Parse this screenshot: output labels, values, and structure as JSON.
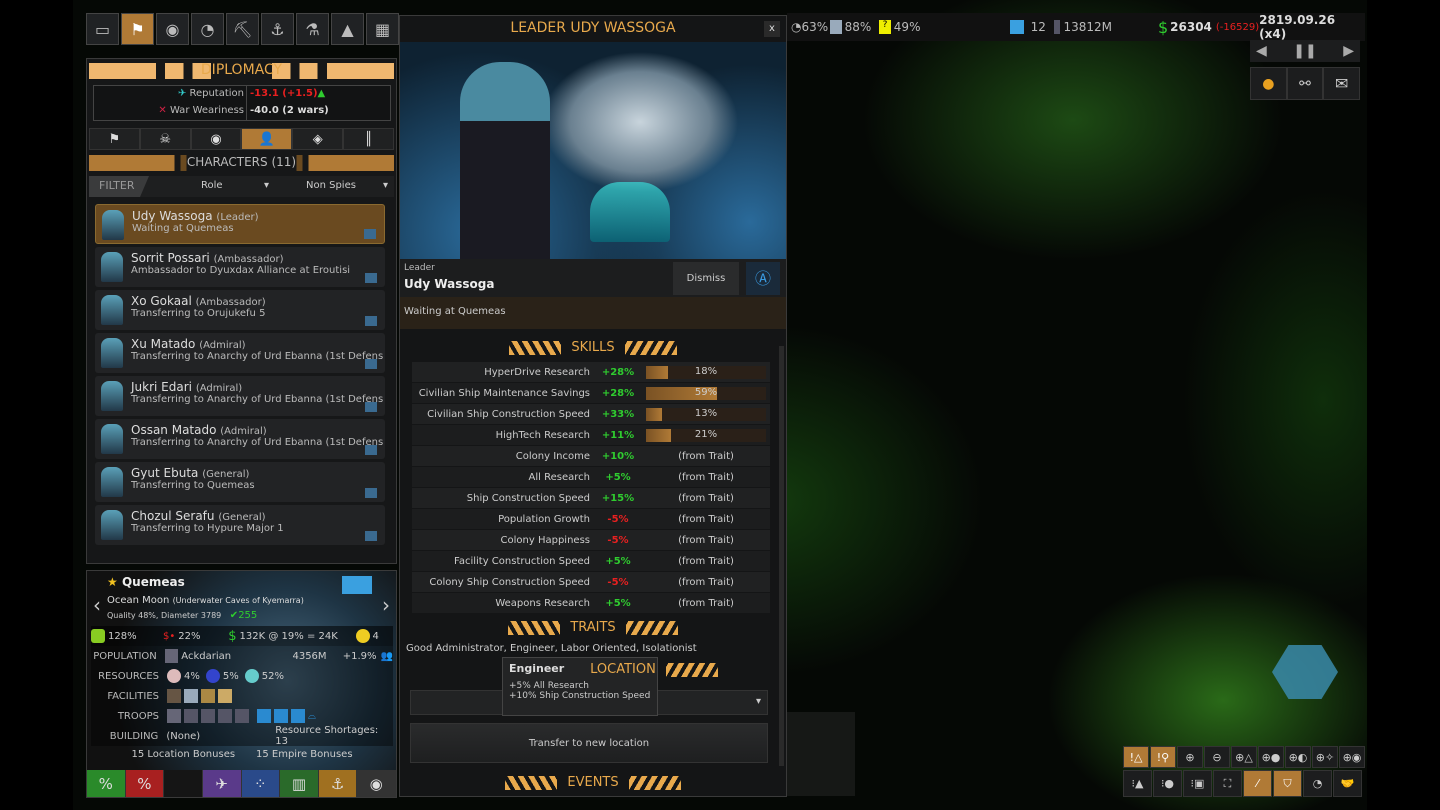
{
  "colors": {
    "accent": "#e8a94c",
    "positive": "#2fcc2f",
    "negative": "#e82020",
    "selected": "#6a4a20"
  },
  "top_icons": [
    {
      "icon": "empire-flag-icon"
    },
    {
      "icon": "diplomacy-flags-icon",
      "active": true
    },
    {
      "icon": "planet-flag-icon"
    },
    {
      "icon": "radar-icon"
    },
    {
      "icon": "pickaxe-icon"
    },
    {
      "icon": "crane-hook-icon"
    },
    {
      "icon": "flask-icon"
    },
    {
      "icon": "fleet-icon"
    },
    {
      "icon": "buildings-icon"
    }
  ],
  "diplomacy": {
    "title": "DIPLOMACY",
    "reputation_label": "Reputation",
    "reputation_value": "-13.1 (+1.5)",
    "war_label": "War Weariness",
    "war_value": "-40.0 (2 wars)",
    "tabs": [
      {
        "icon": "flags-icon"
      },
      {
        "icon": "skull-icon"
      },
      {
        "icon": "planet-flag-icon"
      },
      {
        "icon": "person-icon",
        "active": true
      },
      {
        "icon": "spy-icon"
      },
      {
        "icon": "chart-icon"
      }
    ],
    "characters_title": "CHARACTERS (11)",
    "filter": {
      "label": "FILTER",
      "role": "Role",
      "spies": "Non Spies"
    },
    "characters": [
      {
        "name": "Udy Wassoga",
        "role": "(Leader)",
        "status": "Waiting at Quemeas",
        "selected": true
      },
      {
        "name": "Sorrit Possari",
        "role": "(Ambassador)",
        "status": "Ambassador to Dyuxdax Alliance at Eroutisi"
      },
      {
        "name": "Xo Gokaal",
        "role": "(Ambassador)",
        "status": "Transferring to Orujukefu 5"
      },
      {
        "name": "Xu Matado",
        "role": "(Admiral)",
        "status": "Transferring to Anarchy of Urd Ebanna  (1st Defense"
      },
      {
        "name": "Jukri Edari",
        "role": "(Admiral)",
        "status": "Transferring to Anarchy of Urd Ebanna  (1st Defense"
      },
      {
        "name": "Ossan Matado",
        "role": "(Admiral)",
        "status": "Transferring to Anarchy of Urd Ebanna  (1st Defense"
      },
      {
        "name": "Gyut Ebuta",
        "role": "(General)",
        "status": "Transferring to Quemeas"
      },
      {
        "name": "Chozul Serafu",
        "role": "(General)",
        "status": "Transferring to Hypure Major 1"
      }
    ]
  },
  "planet": {
    "name": "Quemeas",
    "type": "Ocean Moon",
    "subtitle": "(Underwater Caves of Kyemarra)",
    "quality": "Quality 48%, Diameter 3789",
    "score": "255",
    "happiness": "128%",
    "corruption": "22%",
    "income": "132K @ 19% = 24K",
    "mood": "4",
    "population_label": "POPULATION",
    "race": "Ackdarian",
    "population": "4356M",
    "growth": "+1.9%",
    "resources_label": "RESOURCES",
    "resources": [
      "4%",
      "5%",
      "52%"
    ],
    "facilities_label": "FACILITIES",
    "troops_label": "TROOPS",
    "building_label": "BUILDING",
    "building": "(None)",
    "shortages": "Resource Shortages: 13",
    "location_bonuses": "15 Location Bonuses",
    "empire_bonuses": "15 Empire Bonuses",
    "tabs": [
      {
        "icon": "money-bag-icon",
        "color": "#2a8a2a"
      },
      {
        "icon": "money-bag-red-icon",
        "color": "#a82020"
      },
      {
        "icon": "blank-tab",
        "color": "#151515"
      },
      {
        "icon": "fighter-icon",
        "color": "#5a3a8a"
      },
      {
        "icon": "dots-icon",
        "color": "#2a4a8a"
      },
      {
        "icon": "building-icon",
        "color": "#2a6a2a"
      },
      {
        "icon": "crane-hook-icon",
        "color": "#a07020"
      },
      {
        "icon": "planet-flag-icon",
        "color": "#333"
      }
    ]
  },
  "leader": {
    "title": "LEADER UDY WASSOGA",
    "close": "x",
    "role": "Leader",
    "name": "Udy Wassoga",
    "dismiss": "Dismiss",
    "status": "Waiting at Quemeas",
    "skills_title": "SKILLS",
    "skills": [
      {
        "name": "HyperDrive Research",
        "value": "+28%",
        "level": 18,
        "label": "18%"
      },
      {
        "name": "Civilian Ship Maintenance Savings",
        "value": "+28%",
        "level": 59,
        "label": "59%"
      },
      {
        "name": "Civilian Ship Construction Speed",
        "value": "+33%",
        "level": 13,
        "label": "13%"
      },
      {
        "name": "HighTech Research",
        "value": "+11%",
        "level": 21,
        "label": "21%"
      },
      {
        "name": "Colony Income",
        "value": "+10%",
        "note": "(from Trait)"
      },
      {
        "name": "All Research",
        "value": "+5%",
        "note": "(from Trait)"
      },
      {
        "name": "Ship Construction Speed",
        "value": "+15%",
        "note": "(from Trait)"
      },
      {
        "name": "Population Growth",
        "value": "-5%",
        "note": "(from Trait)"
      },
      {
        "name": "Colony Happiness",
        "value": "-5%",
        "note": "(from Trait)"
      },
      {
        "name": "Facility Construction Speed",
        "value": "+5%",
        "note": "(from Trait)"
      },
      {
        "name": "Colony Ship Construction Speed",
        "value": "-5%",
        "note": "(from Trait)"
      },
      {
        "name": "Weapons Research",
        "value": "+5%",
        "note": "(from Trait)"
      }
    ],
    "traits_title": "TRAITS",
    "traits": "Good Administrator, Engineer, Labor Oriented, Isolationist",
    "location_title": "LOCATION",
    "transfer": "Transfer to new location",
    "events_title": "EVENTS",
    "tooltip": {
      "title": "Engineer",
      "lines": [
        "+5% All Research",
        "+10% Ship Construction Speed"
      ]
    }
  },
  "topbar": {
    "stat1": "63%",
    "stat2": "88%",
    "stat3": "49%",
    "colonies": "12",
    "population": "13812M",
    "credits": "26304",
    "cashflow": "(-16529)",
    "date": "2819.09.26 (x4)"
  },
  "map_tools": {
    "row1": [
      "!△",
      "!⚲",
      "⊕",
      "⊖",
      "⊕△",
      "⊕●",
      "⊕◐",
      "⊕✧",
      "⊕◉"
    ],
    "row2": [
      "⁝▲",
      "⁝●",
      "⁝▣",
      "⛶",
      "⁄",
      "⛉",
      "◔",
      "🤝"
    ]
  }
}
